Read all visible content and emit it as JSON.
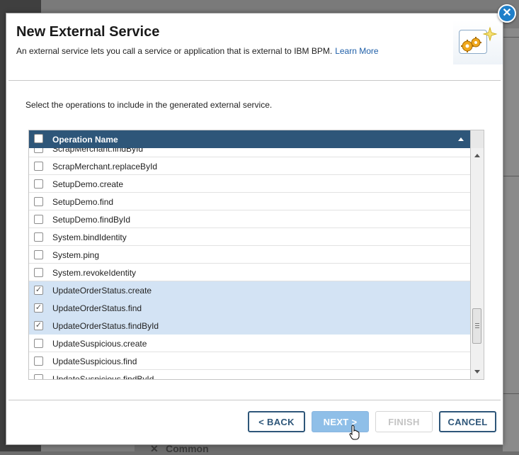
{
  "dialog": {
    "title": "New External Service",
    "description": "An external service lets you call a service or application that is external to IBM BPM.",
    "learn_more": "Learn More",
    "close_symbol": "✕",
    "instruction": "Select the operations to include in the generated external service."
  },
  "grid": {
    "column_header": "Operation Name",
    "sort": "ascending",
    "rows": [
      {
        "name": "ScrapMerchant.findById",
        "checked": false
      },
      {
        "name": "ScrapMerchant.replaceById",
        "checked": false
      },
      {
        "name": "SetupDemo.create",
        "checked": false
      },
      {
        "name": "SetupDemo.find",
        "checked": false
      },
      {
        "name": "SetupDemo.findById",
        "checked": false
      },
      {
        "name": "System.bindIdentity",
        "checked": false
      },
      {
        "name": "System.ping",
        "checked": false
      },
      {
        "name": "System.revokeIdentity",
        "checked": false
      },
      {
        "name": "UpdateOrderStatus.create",
        "checked": true
      },
      {
        "name": "UpdateOrderStatus.find",
        "checked": true
      },
      {
        "name": "UpdateOrderStatus.findById",
        "checked": true
      },
      {
        "name": "UpdateSuspicious.create",
        "checked": false
      },
      {
        "name": "UpdateSuspicious.find",
        "checked": false
      },
      {
        "name": "UpdateSuspicious.findById",
        "checked": false
      }
    ]
  },
  "buttons": {
    "back": "< BACK",
    "next": "NEXT >",
    "finish": "FINISH",
    "cancel": "CANCEL"
  },
  "background": {
    "section_label": "Common",
    "chevron": "✕"
  },
  "colors": {
    "header_bg": "#2e5679",
    "selected_row": "#d3e3f4",
    "primary_button": "#8fbfe8",
    "close_button": "#1f7fc9"
  }
}
